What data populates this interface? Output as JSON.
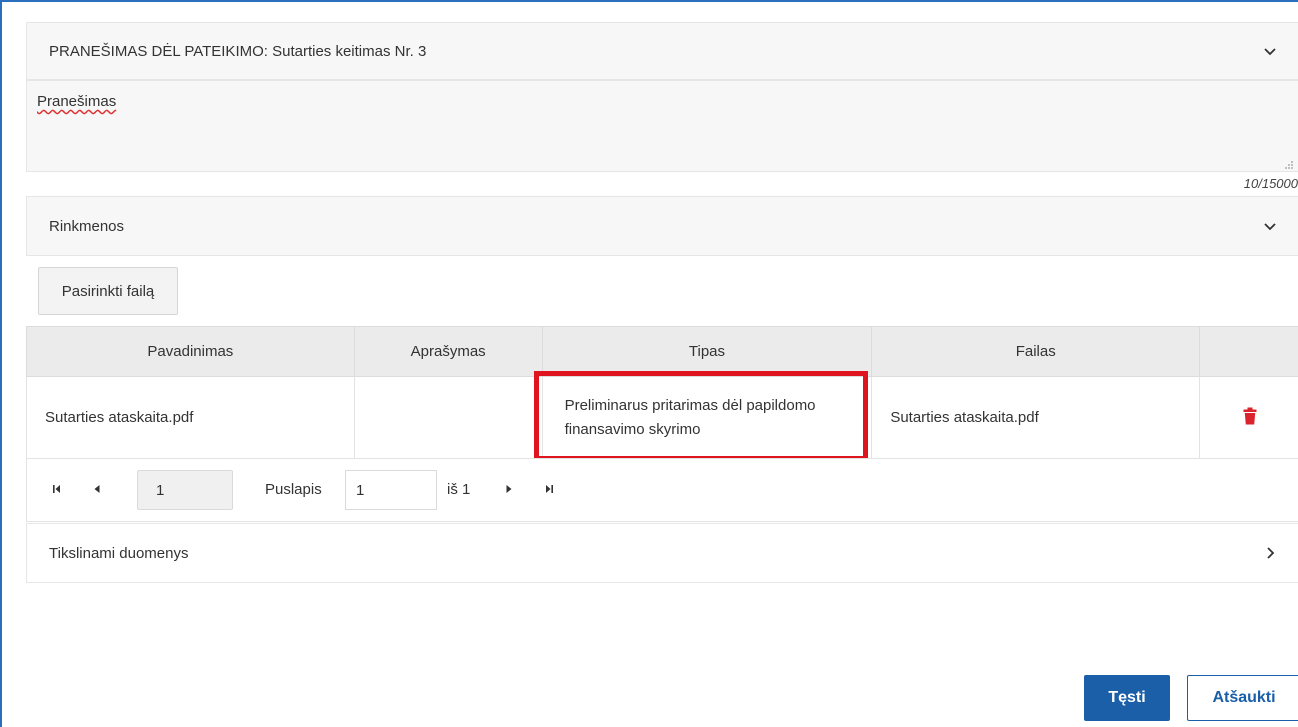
{
  "notice_section": {
    "title": "PRANEŠIMAS DĖL PATEIKIMO: Sutarties keitimas Nr. 3",
    "message_value": "Pranešimas",
    "char_counter": "10/15000"
  },
  "files_section": {
    "title": "Rinkmenos",
    "choose_file_label": "Pasirinkti failą",
    "columns": [
      "Pavadinimas",
      "Aprašymas",
      "Tipas",
      "Failas",
      ""
    ],
    "rows": [
      {
        "name": "Sutarties ataskaita.pdf",
        "description": "",
        "type": "Preliminarus pritarimas dėl papildomo finansavimo skyrimo",
        "file": "Sutarties ataskaita.pdf"
      }
    ],
    "pager": {
      "current_page_button": "1",
      "page_label": "Puslapis",
      "page_input_value": "1",
      "of_label": "iš 1"
    }
  },
  "details_section": {
    "title": "Tikslinami duomenys"
  },
  "footer": {
    "continue_label": "Tęsti",
    "cancel_label": "Atšaukti"
  },
  "colors": {
    "primary": "#1a5fa8",
    "highlight": "#e0141e",
    "delete_icon": "#d9232d"
  }
}
